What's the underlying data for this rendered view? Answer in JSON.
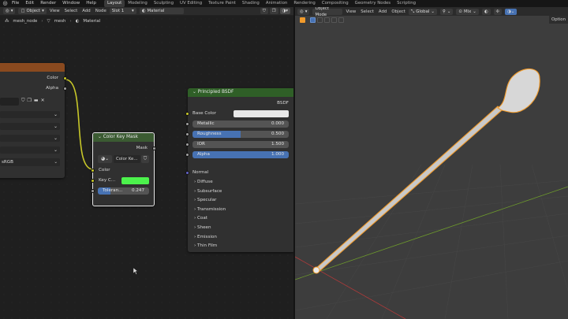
{
  "topbar": {
    "menus": [
      "File",
      "Edit",
      "Render",
      "Window",
      "Help"
    ],
    "workspaces": [
      "Layout",
      "Modeling",
      "Sculpting",
      "UV Editing",
      "Texture Paint",
      "Shading",
      "Animation",
      "Rendering",
      "Compositing",
      "Geometry Nodes",
      "Scripting"
    ],
    "active_workspace": "Layout"
  },
  "node_editor": {
    "mode": "Object",
    "menus": [
      "View",
      "Select",
      "Add",
      "Node"
    ],
    "slot": "Slot 1",
    "material": "Material",
    "breadcrumb": [
      "mesh_node",
      "mesh",
      "Material"
    ]
  },
  "left_node": {
    "outputs": [
      "Color",
      "Alpha"
    ],
    "colorspace": "sRGB"
  },
  "color_key_node": {
    "title": "Color Key Mask",
    "output": "Mask",
    "image_name": "Color Ke...",
    "input_color": "Color",
    "key_color_label": "Key C...",
    "key_color": "#4cf24c",
    "tolerance_label": "Toleran...",
    "tolerance_value": "0.247",
    "tolerance_fraction": 0.247
  },
  "bsdf_node": {
    "title": "Principled BSDF",
    "output": "BSDF",
    "base_color_label": "Base Color",
    "base_color": "#e8e8e8",
    "fields": [
      {
        "label": "Metallic",
        "value": "0.000",
        "fraction": 0.0
      },
      {
        "label": "Roughness",
        "value": "0.500",
        "fraction": 0.5
      },
      {
        "label": "IOR",
        "value": "1.500",
        "fraction": 0.0
      },
      {
        "label": "Alpha",
        "value": "1.000",
        "fraction": 1.0
      }
    ],
    "normal_label": "Normal",
    "panels": [
      "Diffuse",
      "Subsurface",
      "Specular",
      "Transmission",
      "Coat",
      "Sheen",
      "Emission",
      "Thin Film"
    ]
  },
  "viewport": {
    "mode": "Object Mode",
    "menus": [
      "View",
      "Select",
      "Add",
      "Object"
    ],
    "orientation": "Global",
    "mix": "Mix",
    "options_label": "Option"
  },
  "colors": {
    "node_header_texture": "#8a4a1f",
    "node_header_converter": "#3b5b32",
    "node_header_shader": "#2f5f27",
    "accent_blue": "#4772b3",
    "selection_orange": "#f29b2b",
    "axis_red": "#b03a3a",
    "axis_green": "#6d9a2c"
  },
  "icons": {
    "editor_type": "node-editor-icon",
    "viewport_editor_type": "viewport-editor-icon",
    "shield": "fake-user-shield-icon",
    "duplicate": "duplicate-icon",
    "folder": "folder-icon",
    "close": "close-icon"
  }
}
